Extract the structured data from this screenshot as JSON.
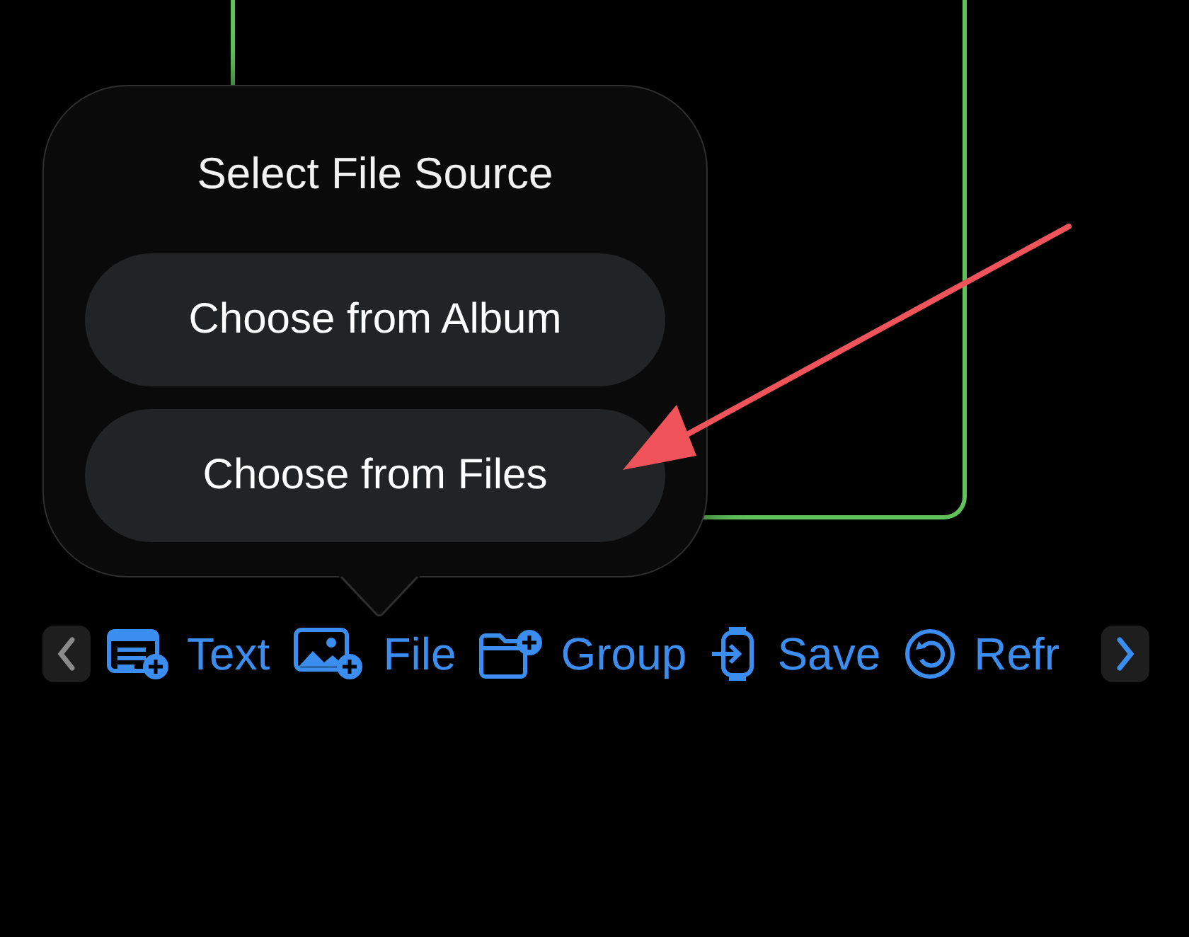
{
  "popover": {
    "title": "Select File Source",
    "options": [
      {
        "label": "Choose from Album"
      },
      {
        "label": "Choose from Files"
      }
    ]
  },
  "toolbar": {
    "scroll_left": {
      "disabled": true
    },
    "scroll_right": {
      "disabled": false
    },
    "items": [
      {
        "kind": "text",
        "label": "Text"
      },
      {
        "kind": "file",
        "label": "File"
      },
      {
        "kind": "group",
        "label": "Group"
      },
      {
        "kind": "save",
        "label": "Save"
      },
      {
        "kind": "refresh",
        "label": "Refr"
      }
    ]
  }
}
